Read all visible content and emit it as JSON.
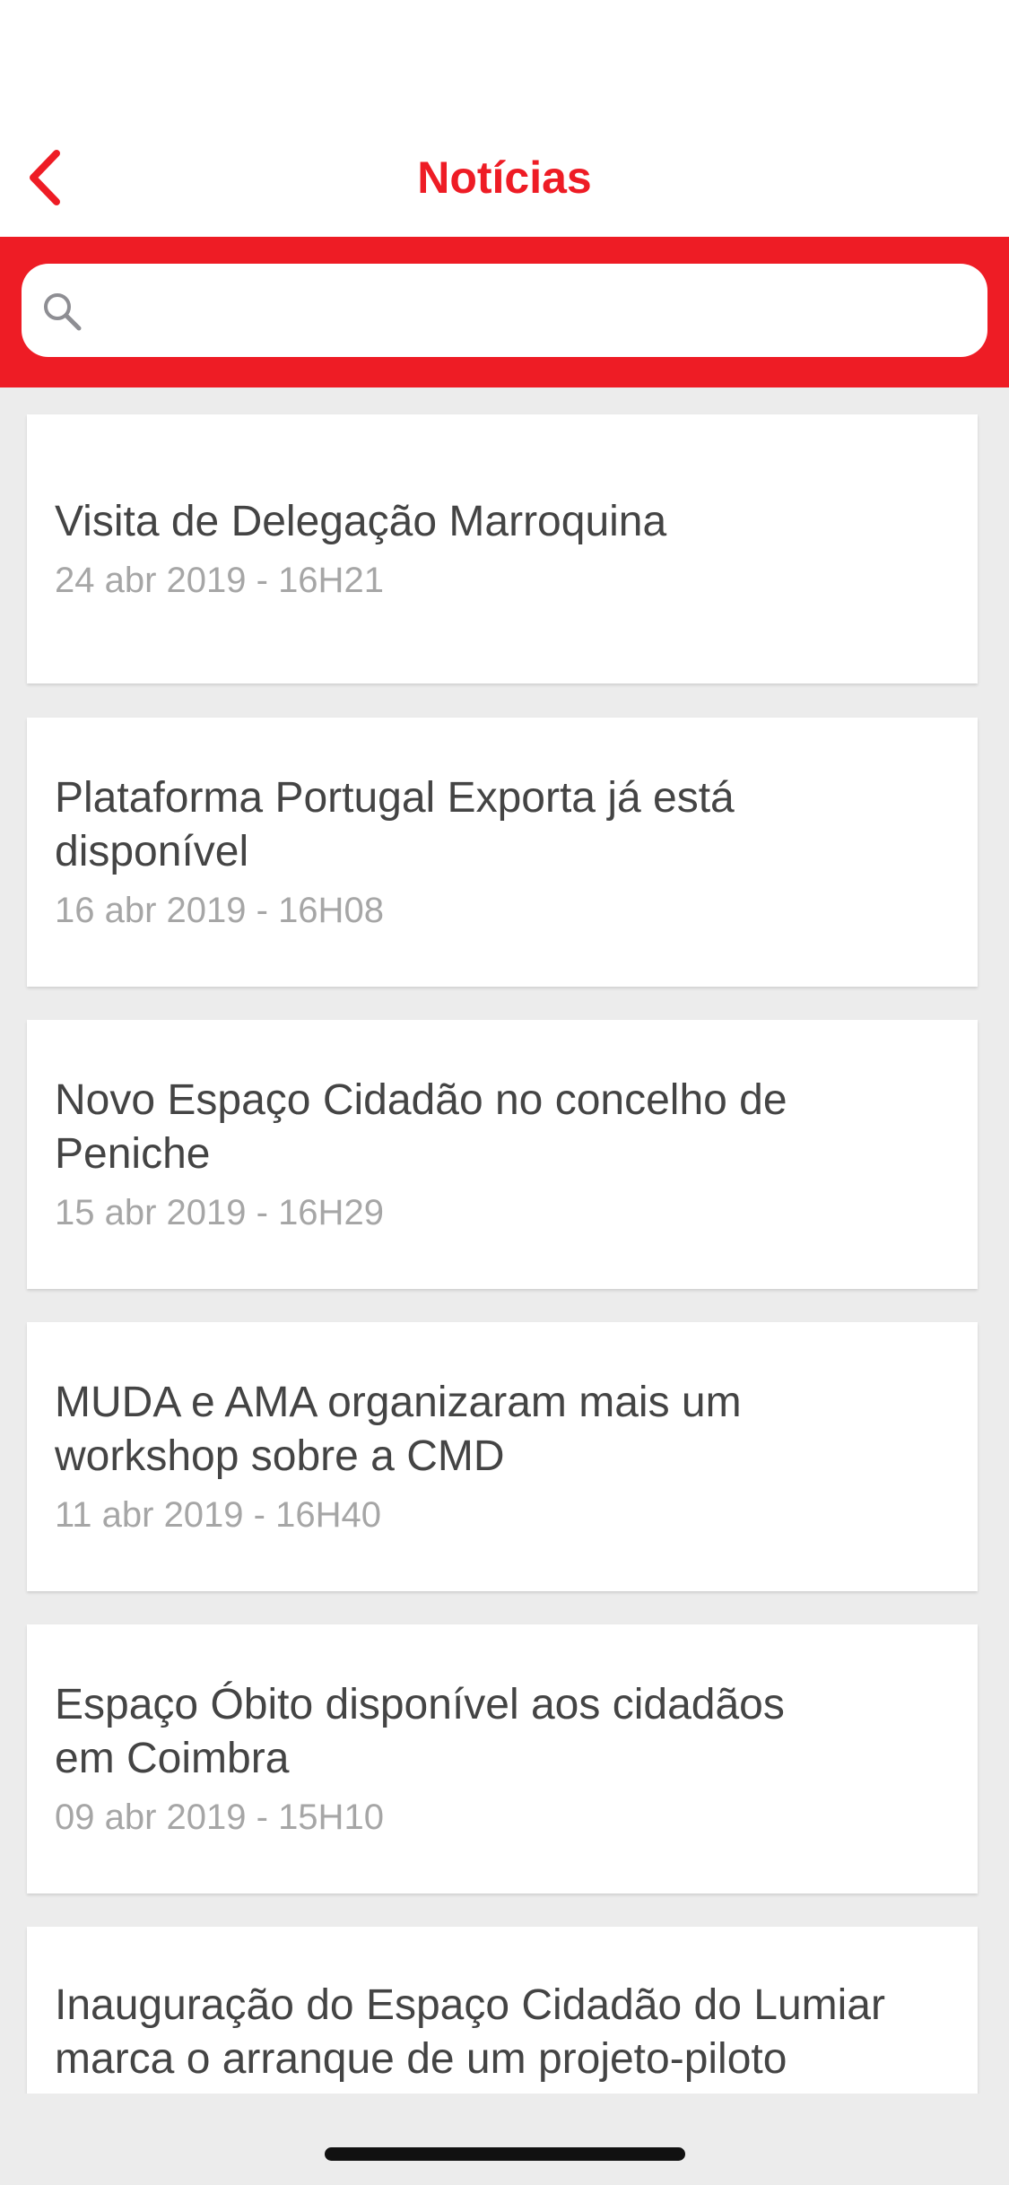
{
  "header": {
    "title": "Notícias",
    "back_icon": "chevron-left-icon",
    "accent_color": "#ee1c25"
  },
  "search": {
    "icon": "search-icon",
    "placeholder": "",
    "value": ""
  },
  "news": [
    {
      "title": "Visita de Delegação Marroquina",
      "date": "24 abr 2019 - 16H21"
    },
    {
      "title": "Plataforma Portugal Exporta já está disponível",
      "date": "16 abr 2019 - 16H08"
    },
    {
      "title": "Novo Espaço Cidadão no concelho de Peniche",
      "date": "15 abr 2019 - 16H29"
    },
    {
      "title": "MUDA e AMA organizaram mais um workshop sobre a CMD",
      "date": "11 abr 2019 - 16H40"
    },
    {
      "title": "Espaço Óbito disponível aos cidadãos em Coimbra",
      "date": "09 abr 2019 - 15H10"
    },
    {
      "title": "Inauguração do Espaço Cidadão do Lumiar marca o arranque de um projeto-piloto",
      "date": ""
    }
  ]
}
